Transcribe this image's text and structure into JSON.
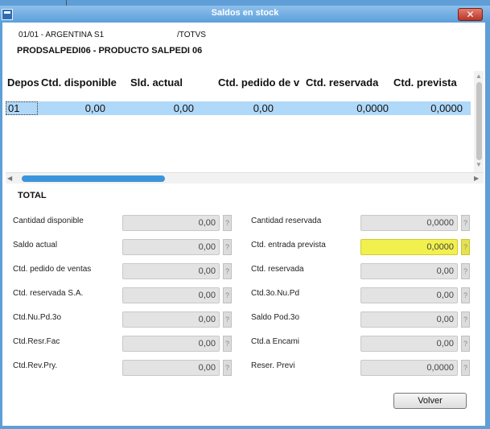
{
  "window": {
    "title": "Saldos en stock",
    "close_glyph": "✕"
  },
  "header": {
    "company": "01/01 - ARGENTINA S1",
    "user": "/TOTVS",
    "product": "PRODSALPEDI06 - PRODUCTO SALPEDI 06"
  },
  "grid": {
    "columns": [
      "Depos",
      "Ctd. disponible",
      "Sld. actual",
      "Ctd. pedido de v",
      "Ctd. reservada",
      "Ctd. prevista"
    ],
    "rows": [
      [
        "01",
        "0,00",
        "0,00",
        "0,00",
        "0,0000",
        "0,0000"
      ]
    ]
  },
  "total": {
    "title": "TOTAL",
    "left_fields": [
      {
        "label": "Cantidad disponible",
        "value": "0,00"
      },
      {
        "label": "Saldo actual",
        "value": "0,00"
      },
      {
        "label": "Ctd. pedido de ventas",
        "value": "0,00"
      },
      {
        "label": "Ctd. reservada S.A.",
        "value": "0,00"
      },
      {
        "label": "Ctd.Nu.Pd.3o",
        "value": "0,00"
      },
      {
        "label": "Ctd.Resr.Fac",
        "value": "0,00"
      },
      {
        "label": "Ctd.Rev.Pry.",
        "value": "0,00"
      }
    ],
    "right_fields": [
      {
        "label": "Cantidad reservada",
        "value": "0,0000"
      },
      {
        "label": "Ctd. entrada prevista",
        "value": "0,0000",
        "highlight": true
      },
      {
        "label": "Ctd. reservada",
        "value": "0,00"
      },
      {
        "label": "Ctd.3o.Nu.Pd",
        "value": "0,00"
      },
      {
        "label": "Saldo Pod.3o",
        "value": "0,00"
      },
      {
        "label": "Ctd.a Encami",
        "value": "0,00"
      },
      {
        "label": "Reser. Previ",
        "value": "0,0000"
      }
    ],
    "help_glyph": "?"
  },
  "buttons": {
    "volver": "Volver"
  },
  "icons": {
    "app": "window-icon",
    "close": "close-icon",
    "up": "scroll-up-arrow-icon",
    "down": "scroll-down-arrow-icon",
    "left": "scroll-left-arrow-icon",
    "right": "scroll-right-arrow-icon",
    "up_glyph": "▲",
    "down_glyph": "▼",
    "left_glyph": "◀",
    "right_glyph": "▶"
  },
  "colors": {
    "highlight": "#f2f04e",
    "selected_row": "#b0d8f8",
    "titlebar": "#5f9ed6"
  }
}
